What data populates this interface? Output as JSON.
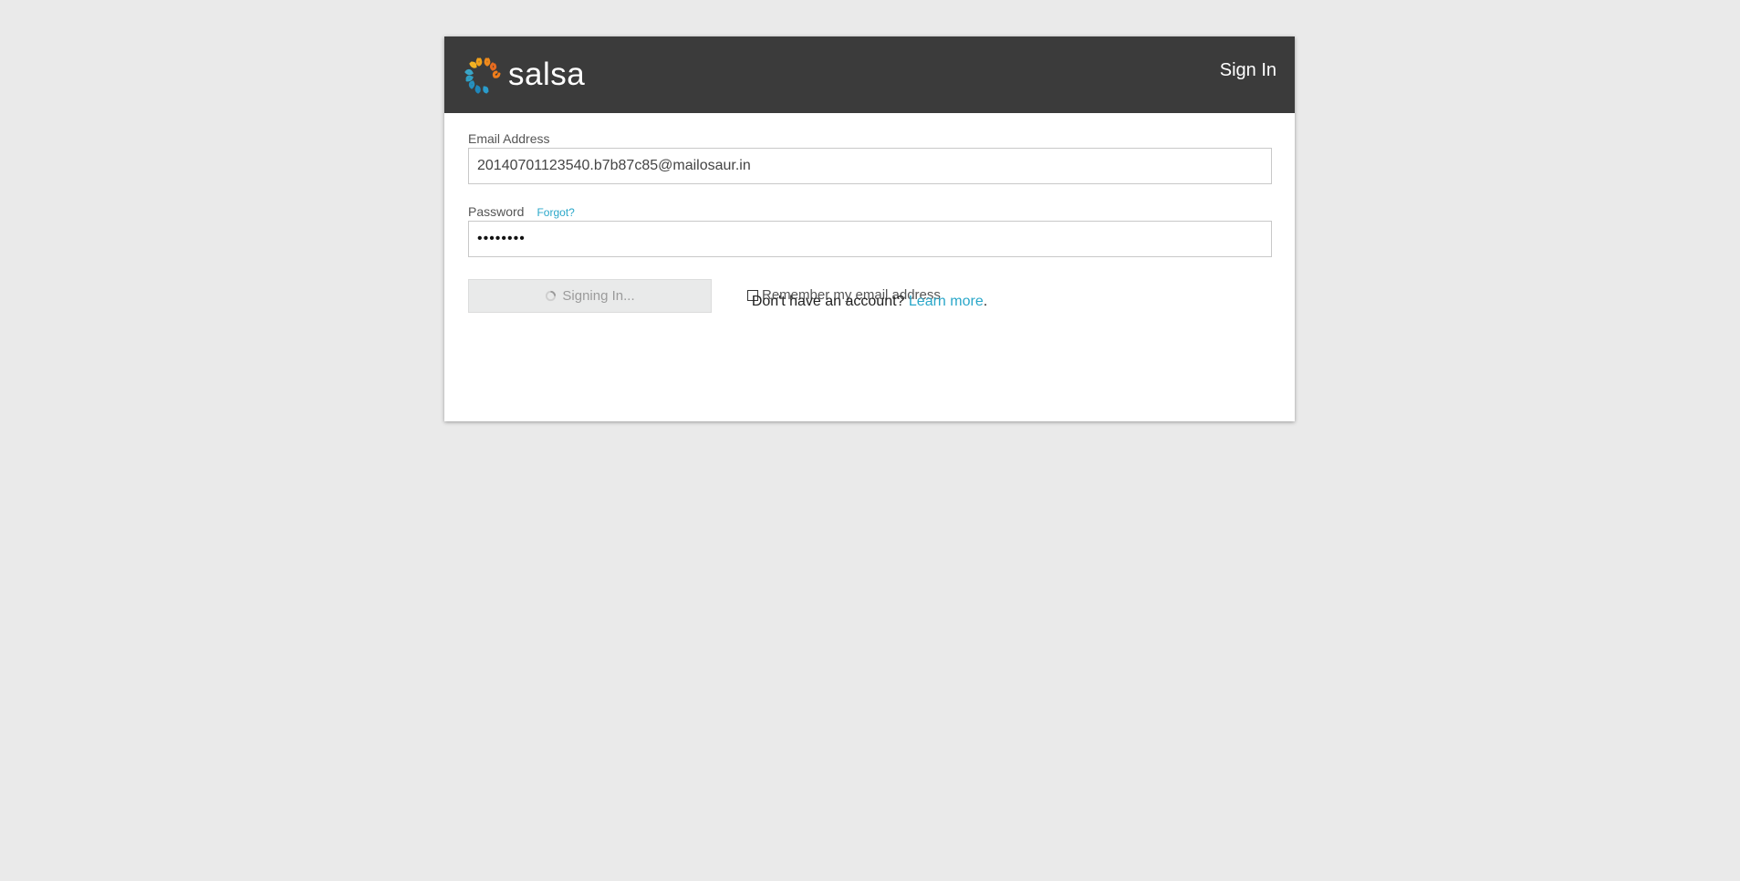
{
  "header": {
    "brand": "salsa",
    "title": "Sign In"
  },
  "form": {
    "email_label": "Email Address",
    "email_value": "20140701123540.b7b87c85@mailosaur.in",
    "password_label": "Password",
    "forgot_link": "Forgot?",
    "password_value": "••••••••",
    "submit_label": "Signing In...",
    "remember_label": "Remember my email address"
  },
  "footer": {
    "prompt": "Don't have an account? ",
    "link": "Learn more",
    "suffix": "."
  },
  "icons": {
    "logo": "salsa-logo-icon",
    "spinner": "loading-spinner-icon"
  },
  "colors": {
    "header_bg": "#3b3b3b",
    "link": "#2aa7c9",
    "page_bg": "#eaeaea"
  }
}
